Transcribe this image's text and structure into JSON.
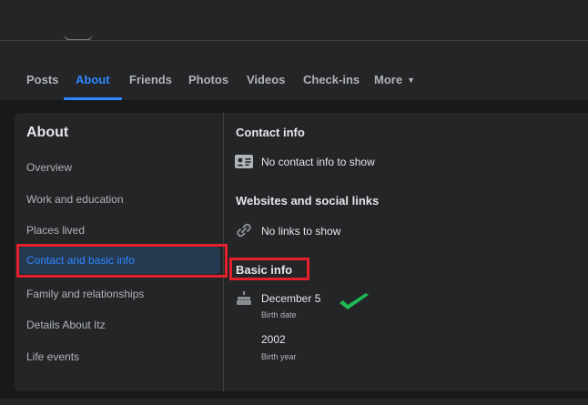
{
  "nav": {
    "tabs": [
      {
        "label": "Posts"
      },
      {
        "label": "About"
      },
      {
        "label": "Friends"
      },
      {
        "label": "Photos"
      },
      {
        "label": "Videos"
      },
      {
        "label": "Check-ins"
      },
      {
        "label": "More",
        "caret": "▼"
      }
    ]
  },
  "sidebar": {
    "title": "About",
    "items": [
      {
        "label": "Overview"
      },
      {
        "label": "Work and education"
      },
      {
        "label": "Places lived"
      },
      {
        "label": "Contact and basic info"
      },
      {
        "label": "Family and relationships"
      },
      {
        "label": "Details About Itz"
      },
      {
        "label": "Life events"
      }
    ]
  },
  "content": {
    "contact": {
      "title": "Contact info",
      "empty_text": "No contact info to show",
      "icon": "contact-card-icon"
    },
    "websites": {
      "title": "Websites and social links",
      "empty_text": "No links to show",
      "icon": "link-icon"
    },
    "basic": {
      "title": "Basic info",
      "birth_date": {
        "value": "December 5",
        "label": "Birth date",
        "icon": "birthday-cake-icon"
      },
      "birth_year": {
        "value": "2002",
        "label": "Birth year"
      }
    }
  },
  "colors": {
    "accent": "#2d88ff",
    "highlight": "#e3202c",
    "check": "#1db954"
  }
}
